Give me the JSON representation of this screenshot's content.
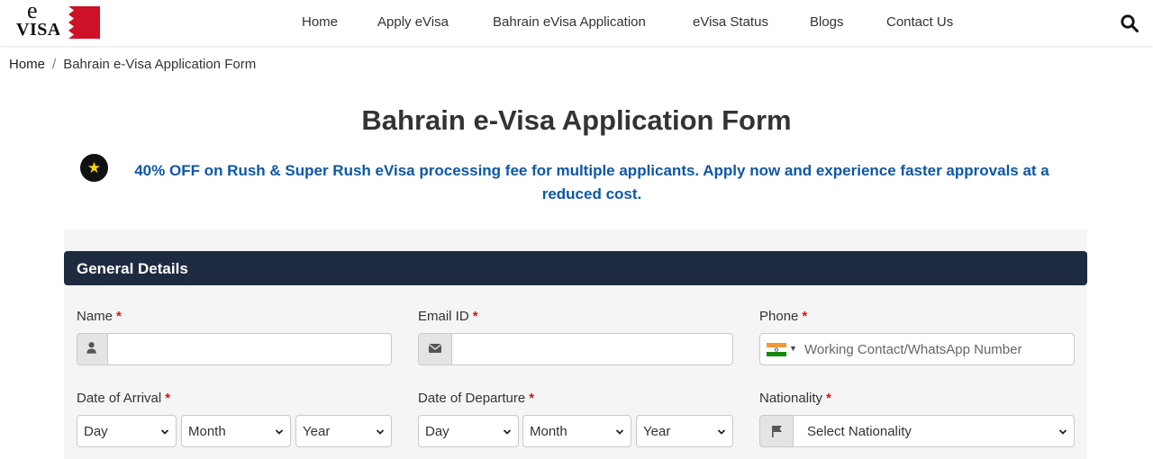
{
  "header": {
    "logo": {
      "letter": "e",
      "word": "VISA",
      "flag_colors": [
        "#ffffff",
        "#ce1126"
      ]
    },
    "nav": [
      {
        "label": "Home"
      },
      {
        "label": "Apply eVisa"
      },
      {
        "label": "Bahrain eVisa Application"
      },
      {
        "label": "eVisa Status"
      },
      {
        "label": "Blogs"
      },
      {
        "label": "Contact Us"
      }
    ],
    "search_icon": "search-icon"
  },
  "breadcrumb": {
    "home": "Home",
    "separator": "/",
    "current": "Bahrain e-Visa Application Form"
  },
  "page": {
    "title": "Bahrain e-Visa Application Form",
    "promo_icon": "star-icon",
    "promo": "40% OFF on Rush & Super Rush eVisa processing fee for multiple applicants. Apply now and experience faster approvals at a reduced cost."
  },
  "form": {
    "section_title": "General Details",
    "required_mark": "*",
    "name": {
      "label": "Name",
      "icon": "user-icon",
      "value": ""
    },
    "email": {
      "label": "Email ID",
      "icon": "envelope-icon",
      "value": ""
    },
    "phone": {
      "label": "Phone",
      "icon": "india-flag-icon",
      "placeholder": "Working Contact/WhatsApp Number"
    },
    "arrival": {
      "label": "Date of Arrival",
      "day": "Day",
      "month": "Month",
      "year": "Year"
    },
    "departure": {
      "label": "Date of Departure",
      "day": "Day",
      "month": "Month",
      "year": "Year"
    },
    "nationality": {
      "label": "Nationality",
      "icon": "flag-icon",
      "value": "Select Nationality"
    }
  },
  "colors": {
    "section_header": "#1e2a3f",
    "promo_text": "#0d57a8",
    "required": "#dd1111",
    "panel_bg": "#f5f5f5"
  }
}
